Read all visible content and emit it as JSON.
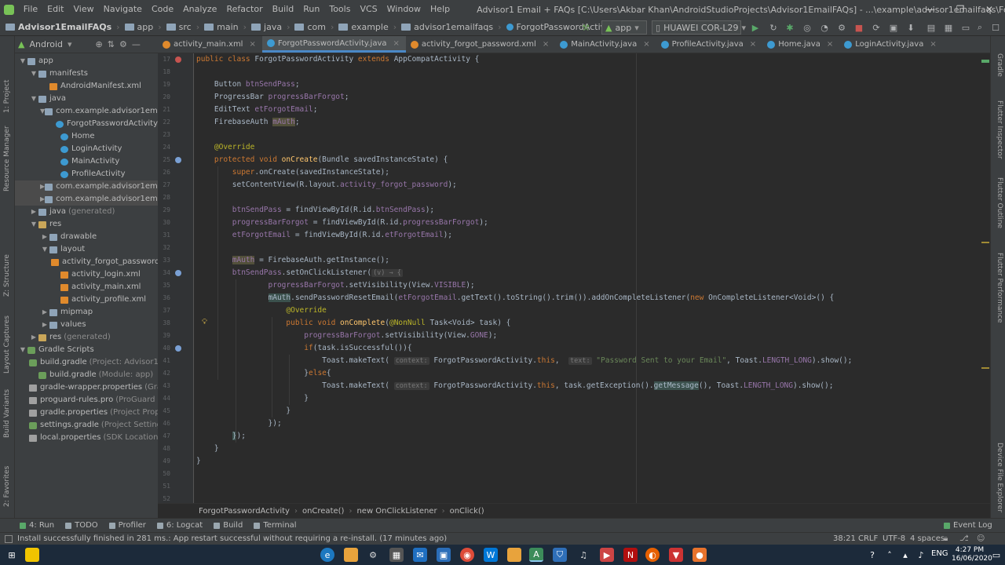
{
  "menu": {
    "items": [
      "File",
      "Edit",
      "View",
      "Navigate",
      "Code",
      "Analyze",
      "Refactor",
      "Build",
      "Run",
      "Tools",
      "VCS",
      "Window",
      "Help"
    ],
    "window_title": "Advisor1 Email + FAQs [C:\\Users\\Akbar Khan\\AndroidStudioProjects\\Advisor1EmailFAQs] - ...\\example\\advisor1emailfaqs\\ForgotPasswordActivity.java [app]",
    "minimize": "—",
    "maximize": "❐",
    "close": "✕"
  },
  "navbar": {
    "crumbs": [
      "Advisor1EmailFAQs",
      "app",
      "src",
      "main",
      "java",
      "com",
      "example",
      "advisor1emailfaqs",
      "ForgotPasswordActivity"
    ],
    "run_config": "app",
    "device": "HUAWEI COR-L29"
  },
  "project": {
    "view_label": "Android",
    "tree": [
      {
        "label": "app",
        "indent": 0,
        "icon": "folder",
        "arrow": "▼"
      },
      {
        "label": "manifests",
        "indent": 1,
        "icon": "folder",
        "arrow": "▼"
      },
      {
        "label": "AndroidManifest.xml",
        "indent": 2,
        "icon": "xml",
        "arrow": ""
      },
      {
        "label": "java",
        "indent": 1,
        "icon": "folder",
        "arrow": "▼"
      },
      {
        "label": "com.example.advisor1emailfa",
        "indent": 2,
        "icon": "folder",
        "arrow": "▼"
      },
      {
        "label": "ForgotPasswordActivity",
        "indent": 3,
        "icon": "class",
        "arrow": ""
      },
      {
        "label": "Home",
        "indent": 3,
        "icon": "class",
        "arrow": ""
      },
      {
        "label": "LoginActivity",
        "indent": 3,
        "icon": "class",
        "arrow": ""
      },
      {
        "label": "MainActivity",
        "indent": 3,
        "icon": "class",
        "arrow": ""
      },
      {
        "label": "ProfileActivity",
        "indent": 3,
        "icon": "class",
        "arrow": ""
      },
      {
        "label": "com.example.advisor1emailfa",
        "indent": 2,
        "icon": "folder",
        "arrow": "▶",
        "selected": true
      },
      {
        "label": "com.example.advisor1emailfa",
        "indent": 2,
        "icon": "folder",
        "arrow": "▶",
        "selected": true
      },
      {
        "label": "java",
        "indent": 1,
        "icon": "folder",
        "arrow": "▶",
        "note": "(generated)"
      },
      {
        "label": "res",
        "indent": 1,
        "icon": "res",
        "arrow": "▼"
      },
      {
        "label": "drawable",
        "indent": 2,
        "icon": "folder",
        "arrow": "▶"
      },
      {
        "label": "layout",
        "indent": 2,
        "icon": "folder",
        "arrow": "▼"
      },
      {
        "label": "activity_forgot_password.",
        "indent": 3,
        "icon": "xml",
        "arrow": ""
      },
      {
        "label": "activity_login.xml",
        "indent": 3,
        "icon": "xml",
        "arrow": ""
      },
      {
        "label": "activity_main.xml",
        "indent": 3,
        "icon": "xml",
        "arrow": ""
      },
      {
        "label": "activity_profile.xml",
        "indent": 3,
        "icon": "xml",
        "arrow": ""
      },
      {
        "label": "mipmap",
        "indent": 2,
        "icon": "folder",
        "arrow": "▶"
      },
      {
        "label": "values",
        "indent": 2,
        "icon": "folder",
        "arrow": "▶"
      },
      {
        "label": "res",
        "indent": 1,
        "icon": "res",
        "arrow": "▶",
        "note": "(generated)"
      },
      {
        "label": "Gradle Scripts",
        "indent": 0,
        "icon": "gradle",
        "arrow": "▼"
      },
      {
        "label": "build.gradle",
        "indent": 1,
        "icon": "gradle",
        "arrow": "",
        "note": "(Project: Advisor1 Er"
      },
      {
        "label": "build.gradle",
        "indent": 1,
        "icon": "gradle",
        "arrow": "",
        "note": "(Module: app)"
      },
      {
        "label": "gradle-wrapper.properties",
        "indent": 1,
        "icon": "file",
        "arrow": "",
        "note": "(Gradl"
      },
      {
        "label": "proguard-rules.pro",
        "indent": 1,
        "icon": "file",
        "arrow": "",
        "note": "(ProGuard Ru"
      },
      {
        "label": "gradle.properties",
        "indent": 1,
        "icon": "file",
        "arrow": "",
        "note": "(Project Proper"
      },
      {
        "label": "settings.gradle",
        "indent": 1,
        "icon": "gradle",
        "arrow": "",
        "note": "(Project Settings)"
      },
      {
        "label": "local.properties",
        "indent": 1,
        "icon": "file",
        "arrow": "",
        "note": "(SDK Location)"
      }
    ]
  },
  "tabs": [
    {
      "label": "activity_main.xml",
      "color": "#e08a2c"
    },
    {
      "label": "ForgotPasswordActivity.java",
      "color": "#3d9ad1",
      "active": true
    },
    {
      "label": "activity_forgot_password.xml",
      "color": "#e08a2c"
    },
    {
      "label": "MainActivity.java",
      "color": "#3d9ad1"
    },
    {
      "label": "ProfileActivity.java",
      "color": "#3d9ad1"
    },
    {
      "label": "Home.java",
      "color": "#3d9ad1"
    },
    {
      "label": "LoginActivity.java",
      "color": "#3d9ad1"
    }
  ],
  "editor": {
    "line_numbers": [
      "17",
      "18",
      "19",
      "20",
      "21",
      "22",
      "23",
      "24",
      "25",
      "26",
      "27",
      "28",
      "29",
      "30",
      "31",
      "32",
      "33",
      "34",
      "35",
      "36",
      "37",
      "38",
      "39",
      "40",
      "41",
      "42",
      "43",
      "44",
      "45",
      "46",
      "47",
      "48",
      "49",
      "50",
      "51",
      "52",
      "53"
    ],
    "code": [
      {
        "indent": 0,
        "parts": [
          [
            "kw",
            "public class "
          ],
          [
            "",
            "ForgotPasswordActivity "
          ],
          [
            "kw",
            "extends "
          ],
          [
            "",
            "AppCompatActivity {"
          ]
        ]
      },
      {
        "indent": 0,
        "parts": []
      },
      {
        "indent": 4,
        "parts": [
          [
            "",
            "Button "
          ],
          [
            "fd",
            "btnSendPass"
          ],
          [
            "",
            ";"
          ]
        ]
      },
      {
        "indent": 4,
        "parts": [
          [
            "",
            "ProgressBar "
          ],
          [
            "fd",
            "progressBarForgot"
          ],
          [
            "",
            ";"
          ]
        ]
      },
      {
        "indent": 4,
        "parts": [
          [
            "",
            "EditText "
          ],
          [
            "fd",
            "etForgotEmail"
          ],
          [
            "",
            ";"
          ]
        ]
      },
      {
        "indent": 4,
        "parts": [
          [
            "",
            "FirebaseAuth "
          ],
          [
            "fd warn",
            "mAuth"
          ],
          [
            "",
            ";"
          ]
        ]
      },
      {
        "indent": 0,
        "parts": []
      },
      {
        "indent": 4,
        "parts": [
          [
            "an",
            "@Override"
          ]
        ]
      },
      {
        "indent": 4,
        "parts": [
          [
            "kw",
            "protected void "
          ],
          [
            "mt",
            "onCreate"
          ],
          [
            "",
            "(Bundle savedInstanceState) {"
          ]
        ]
      },
      {
        "indent": 8,
        "parts": [
          [
            "kw",
            "super"
          ],
          [
            "",
            ".onCreate(savedInstanceState);"
          ]
        ]
      },
      {
        "indent": 8,
        "parts": [
          [
            "",
            "setContentView(R.layout."
          ],
          [
            "fd",
            "activity_forgot_password"
          ],
          [
            "",
            ");"
          ]
        ]
      },
      {
        "indent": 0,
        "parts": []
      },
      {
        "indent": 8,
        "parts": [
          [
            "fd",
            "btnSendPass "
          ],
          [
            "",
            "= findViewById(R.id."
          ],
          [
            "fd",
            "btnSendPass"
          ],
          [
            "",
            ");"
          ]
        ]
      },
      {
        "indent": 8,
        "parts": [
          [
            "fd",
            "progressBarForgot "
          ],
          [
            "",
            "= findViewById(R.id."
          ],
          [
            "fd",
            "progressBarForgot"
          ],
          [
            "",
            ");"
          ]
        ]
      },
      {
        "indent": 8,
        "parts": [
          [
            "fd",
            "etForgotEmail "
          ],
          [
            "",
            "= findViewById(R.id."
          ],
          [
            "fd",
            "etForgotEmail"
          ],
          [
            "",
            ");"
          ]
        ]
      },
      {
        "indent": 0,
        "parts": []
      },
      {
        "indent": 8,
        "parts": [
          [
            "fd warn",
            "mAuth"
          ],
          [
            "",
            " = FirebaseAuth."
          ],
          [
            "",
            "getInstance();"
          ]
        ]
      },
      {
        "indent": 8,
        "parts": [
          [
            "fd",
            "btnSendPass"
          ],
          [
            "",
            ".setOnClickListener("
          ],
          [
            "ph",
            "(v) → {"
          ]
        ]
      },
      {
        "indent": 16,
        "parts": [
          [
            "fd",
            "progressBarForgot"
          ],
          [
            "",
            ".setVisibility(View."
          ],
          [
            "fd",
            "VISIBLE"
          ],
          [
            "",
            ");"
          ]
        ]
      },
      {
        "indent": 16,
        "parts": [
          [
            "fd hl",
            "mAuth"
          ],
          [
            "",
            ".sendPasswordResetEmail("
          ],
          [
            "fd",
            "etForgotEmail"
          ],
          [
            "",
            ".getText().toString().trim()).addOnCompleteListener("
          ],
          [
            "kw",
            "new "
          ],
          [
            "",
            "OnCompleteListener<Void>() {"
          ]
        ]
      },
      {
        "indent": 20,
        "parts": [
          [
            "an",
            "@Override"
          ]
        ]
      },
      {
        "indent": 20,
        "parts": [
          [
            "kw",
            "public void "
          ],
          [
            "mt",
            "onComplete"
          ],
          [
            "",
            "("
          ],
          [
            "an",
            "@NonNull "
          ],
          [
            "",
            "Task<Void> task) {"
          ]
        ]
      },
      {
        "indent": 24,
        "parts": [
          [
            "fd",
            "progressBarForgot"
          ],
          [
            "",
            ".setVisibility(View."
          ],
          [
            "fd",
            "GONE"
          ],
          [
            "",
            ");"
          ]
        ]
      },
      {
        "indent": 24,
        "parts": [
          [
            "kw",
            "if"
          ],
          [
            "",
            "(task.isSuccessful()){"
          ]
        ]
      },
      {
        "indent": 28,
        "parts": [
          [
            "",
            "Toast."
          ],
          [
            "",
            "makeText( "
          ],
          [
            "ph",
            "context:"
          ],
          [
            "",
            " ForgotPasswordActivity."
          ],
          [
            "kw",
            "this"
          ],
          [
            "",
            ",  "
          ],
          [
            "ph",
            "text:"
          ],
          [
            "st",
            " \"Password Sent to your Email\""
          ],
          [
            "",
            ", Toast."
          ],
          [
            "fd",
            "LENGTH_LONG"
          ],
          [
            "",
            ").show();"
          ]
        ]
      },
      {
        "indent": 24,
        "parts": [
          [
            "",
            "}"
          ],
          [
            "kw",
            "else"
          ],
          [
            "",
            "{"
          ]
        ]
      },
      {
        "indent": 28,
        "parts": [
          [
            "",
            "Toast."
          ],
          [
            "",
            "makeText( "
          ],
          [
            "ph",
            "context:"
          ],
          [
            "",
            " ForgotPasswordActivity."
          ],
          [
            "kw",
            "this"
          ],
          [
            "",
            ", task.getException()."
          ],
          [
            "hl",
            "getMessage"
          ],
          [
            "",
            "(), Toast."
          ],
          [
            "fd",
            "LENGTH_LONG"
          ],
          [
            "",
            ").show();"
          ]
        ]
      },
      {
        "indent": 24,
        "parts": [
          [
            "",
            "}"
          ]
        ]
      },
      {
        "indent": 20,
        "parts": [
          [
            "",
            "}"
          ]
        ]
      },
      {
        "indent": 16,
        "parts": [
          [
            "",
            "});"
          ]
        ]
      },
      {
        "indent": 8,
        "parts": [
          [
            "hl",
            "}"
          ],
          [
            "",
            ");"
          ]
        ]
      },
      {
        "indent": 4,
        "parts": [
          [
            "",
            "}"
          ]
        ]
      },
      {
        "indent": 0,
        "parts": [
          [
            "",
            "}"
          ]
        ]
      },
      {
        "indent": 0,
        "parts": []
      }
    ]
  },
  "breadcrumb_bottom": [
    "ForgotPasswordActivity",
    "onCreate()",
    "new OnClickListener",
    "onClick()"
  ],
  "tool_windows": [
    {
      "label": "4: Run",
      "color": "#59a869"
    },
    {
      "label": "TODO",
      "color": "#9aa7b0"
    },
    {
      "label": "Profiler",
      "color": "#9aa7b0"
    },
    {
      "label": "6: Logcat",
      "color": "#9aa7b0"
    },
    {
      "label": "Build",
      "color": "#9aa7b0"
    },
    {
      "label": "Terminal",
      "color": "#9aa7b0"
    }
  ],
  "event_log": "Event Log",
  "status": {
    "message": "Install successfully finished in 281 ms.: App restart successful without requiring a re-install. (17 minutes ago)",
    "position": "38:21",
    "line_sep": "CRLF",
    "encoding": "UTF-8",
    "indent": "4 spaces"
  },
  "side_tools": {
    "left": [
      "1: Project",
      "Resource Manager",
      "Z: Structure",
      "Layout Captures",
      "Build Variants",
      "2: Favorites"
    ],
    "right": [
      "Gradle",
      "Flutter Inspector",
      "Flutter Outline",
      "Flutter Performance",
      "Device File Explorer"
    ]
  },
  "taskbar": {
    "time": "4:27 PM",
    "date": "16/06/2020",
    "lang": "ENG"
  }
}
